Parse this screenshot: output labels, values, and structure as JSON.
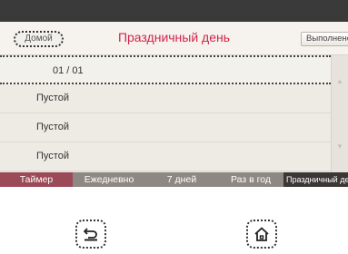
{
  "header": {
    "home_label": "Домой",
    "title": "Праздничный день",
    "done_label": "Выполнено"
  },
  "list": {
    "date": "01 / 01",
    "items": [
      "Пустой",
      "Пустой",
      "Пустой"
    ]
  },
  "tabs": [
    "Таймер",
    "Ежедневно",
    "7 дней",
    "Раз в год",
    "Праздничный день"
  ],
  "selected_tab": "Праздничный день",
  "colors": {
    "title": "#d2234b",
    "timer_tab": "#9b4a57",
    "active_tab": "#3b3735",
    "tab_bar": "#8e8884"
  },
  "icons": {
    "back": "back-arrow-icon",
    "home": "home-icon"
  }
}
